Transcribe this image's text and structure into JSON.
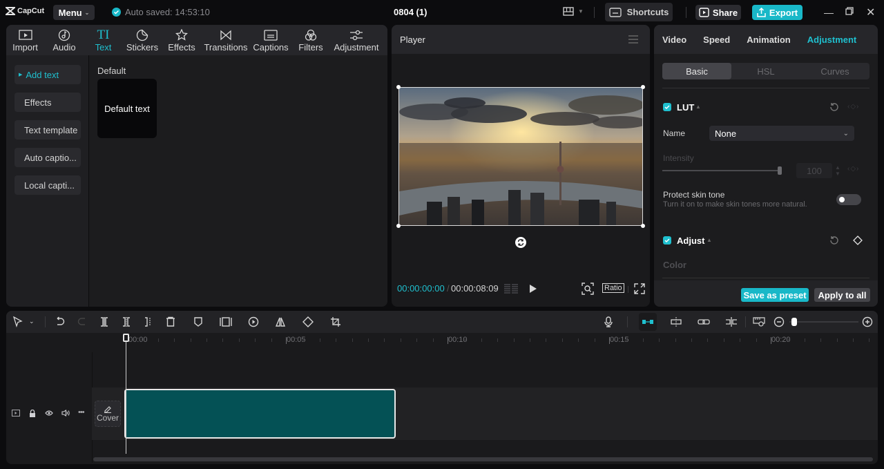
{
  "titlebar": {
    "app_name": "CapCut",
    "menu_label": "Menu",
    "autosave_text": "Auto saved: 14:53:10",
    "project_title": "0804 (1)",
    "shortcuts_label": "Shortcuts",
    "share_label": "Share",
    "export_label": "Export",
    "accent_color": "#19b8c8"
  },
  "media": {
    "tabs": [
      {
        "label": "Import",
        "icon": "import-icon"
      },
      {
        "label": "Audio",
        "icon": "audio-icon"
      },
      {
        "label": "Text",
        "icon": "text-icon",
        "active": true
      },
      {
        "label": "Stickers",
        "icon": "stickers-icon"
      },
      {
        "label": "Effects",
        "icon": "effects-icon"
      },
      {
        "label": "Transitions",
        "icon": "transitions-icon"
      },
      {
        "label": "Captions",
        "icon": "captions-icon"
      },
      {
        "label": "Filters",
        "icon": "filters-icon"
      },
      {
        "label": "Adjustment",
        "icon": "adjustment-icon"
      }
    ],
    "left_nav": [
      {
        "label": "Add text",
        "active": true
      },
      {
        "label": "Effects"
      },
      {
        "label": "Text template"
      },
      {
        "label": "Auto captio..."
      },
      {
        "label": "Local capti..."
      }
    ],
    "section_title": "Default",
    "card_label": "Default text"
  },
  "player": {
    "title": "Player",
    "current_time": "00:00:00:00",
    "separator": "/",
    "total_time": "00:00:08:09",
    "ratio_label": "Ratio"
  },
  "inspector": {
    "tabs": [
      "Video",
      "Speed",
      "Animation",
      "Adjustment"
    ],
    "active_tab": "Adjustment",
    "sub_tabs": [
      "Basic",
      "HSL",
      "Curves"
    ],
    "active_sub_tab": "Basic",
    "lut": {
      "title": "LUT",
      "checked": true,
      "name_label": "Name",
      "name_value": "None",
      "intensity_label": "Intensity",
      "intensity_value": "100",
      "intensity_fraction": 1.0
    },
    "protect_skin": {
      "title": "Protect skin tone",
      "description": "Turn it on to make skin tones more natural.",
      "enabled": false
    },
    "adjust": {
      "title": "Adjust",
      "checked": true,
      "color_label": "Color"
    },
    "save_preset_label": "Save as preset",
    "apply_all_label": "Apply to all"
  },
  "timeline": {
    "ruler_labels": [
      "00:00",
      "00:05",
      "00:10",
      "00:15",
      "00:20"
    ],
    "cover_label": "Cover",
    "zoom_fraction": 0.05,
    "clip_color": "#045155"
  }
}
